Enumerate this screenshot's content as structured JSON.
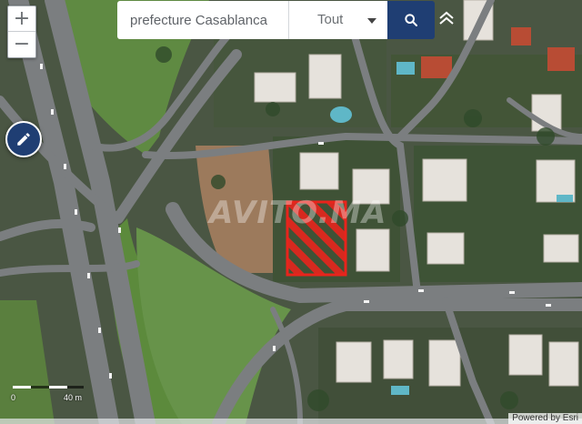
{
  "search": {
    "value": "prefecture Casablanca"
  },
  "filter": {
    "selected": "Tout"
  },
  "controls": {
    "zoom_in": "+",
    "zoom_out": "−"
  },
  "scale": {
    "start": "0",
    "end": "40 m"
  },
  "attribution": "Powered by Esri",
  "watermark": "AVITO.MA",
  "colors": {
    "accent": "#1f3e73",
    "marker": "#e8241c"
  }
}
